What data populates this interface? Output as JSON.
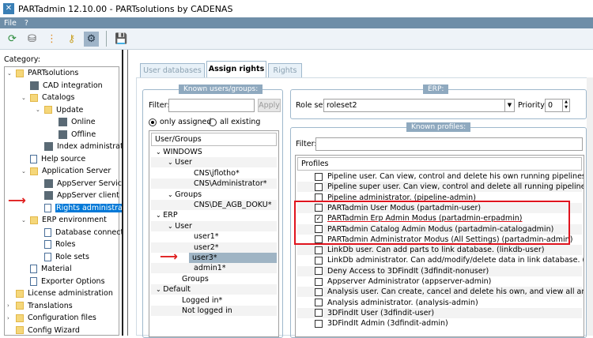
{
  "window": {
    "title": "PARTadmin 12.10.00 - PARTsolutions by CADENAS"
  },
  "menu": [
    "File",
    "?"
  ],
  "toolbar": {
    "icons": [
      "update-icon",
      "database-icon",
      "index-icon",
      "keys-icon",
      "settings-icon",
      "save-icon"
    ]
  },
  "category": {
    "label": "Category:",
    "tree": [
      {
        "label": "PARTsolutions",
        "level": 0,
        "icon": "folder",
        "exp": "v"
      },
      {
        "label": "CAD integration",
        "level": 1,
        "icon": "app"
      },
      {
        "label": "Catalogs",
        "level": 1,
        "icon": "folder",
        "exp": "v"
      },
      {
        "label": "Update",
        "level": 2,
        "icon": "folder",
        "exp": "v"
      },
      {
        "label": "Online",
        "level": 3,
        "icon": "app"
      },
      {
        "label": "Offline",
        "level": 3,
        "icon": "app"
      },
      {
        "label": "Index administration",
        "level": 2,
        "icon": "app"
      },
      {
        "label": "Help source",
        "level": 1,
        "icon": "doc"
      },
      {
        "label": "Application Server",
        "level": 1,
        "icon": "folder",
        "exp": "v"
      },
      {
        "label": "AppServer Service",
        "level": 2,
        "icon": "app"
      },
      {
        "label": "AppServer client",
        "level": 2,
        "icon": "app"
      },
      {
        "label": "Rights administration",
        "level": 2,
        "icon": "doc",
        "selected": true
      },
      {
        "label": "ERP environment",
        "level": 1,
        "icon": "folder",
        "exp": "v"
      },
      {
        "label": "Database connection",
        "level": 2,
        "icon": "doc"
      },
      {
        "label": "Roles",
        "level": 2,
        "icon": "doc"
      },
      {
        "label": "Role sets",
        "level": 2,
        "icon": "doc"
      },
      {
        "label": "Material",
        "level": 1,
        "icon": "doc"
      },
      {
        "label": "Exporter Options",
        "level": 1,
        "icon": "doc"
      },
      {
        "label": "License administration",
        "level": 0,
        "icon": "folder"
      },
      {
        "label": "Translations",
        "level": 0,
        "icon": "folder",
        "exp": ">"
      },
      {
        "label": "Configuration files",
        "level": 0,
        "icon": "folder",
        "exp": ">"
      },
      {
        "label": "Config Wizard",
        "level": 0,
        "icon": "folder"
      }
    ]
  },
  "tabs": [
    {
      "label": "User databases"
    },
    {
      "label": "Assign rights",
      "active": true
    },
    {
      "label": "Rights"
    }
  ],
  "users": {
    "group_title": "Known users/groups:",
    "filter_label": "Filter:",
    "filter_value": "",
    "apply": "Apply",
    "radio_assigned": "only assigned",
    "radio_all": "all existing",
    "header": "User/Groups",
    "rows": [
      {
        "label": "WINDOWS",
        "level": 0,
        "exp": "v"
      },
      {
        "label": "User",
        "level": 1,
        "exp": "v"
      },
      {
        "label": "CNS\\jflotho*",
        "level": 2
      },
      {
        "label": "CNS\\Administrator*",
        "level": 2
      },
      {
        "label": "Groups",
        "level": 1,
        "exp": "v"
      },
      {
        "label": "CNS\\DE_AGB_DOKU*",
        "level": 2
      },
      {
        "label": "ERP",
        "level": 0,
        "exp": "v"
      },
      {
        "label": "User",
        "level": 1,
        "exp": "v"
      },
      {
        "label": "user1*",
        "level": 2
      },
      {
        "label": "user2*",
        "level": 2
      },
      {
        "label": "user3*",
        "level": 2,
        "selected": true
      },
      {
        "label": "admin1*",
        "level": 2
      },
      {
        "label": "Groups",
        "level": 1
      },
      {
        "label": "Default",
        "level": 0,
        "exp": "v"
      },
      {
        "label": "Logged in*",
        "level": 1
      },
      {
        "label": "Not logged in",
        "level": 1
      }
    ]
  },
  "erp": {
    "group_title": "ERP:",
    "roleset_label": "Role set:",
    "roleset_value": "roleset2",
    "priority_label": "Priority:",
    "priority_value": "0"
  },
  "profiles": {
    "group_title": "Known profiles:",
    "filter_label": "Filter:",
    "filter_value": "",
    "header": "Profiles",
    "rows": [
      {
        "label": "Pipeline user. Can view, control and delete his own running pipelines. Can vie...",
        "checked": false
      },
      {
        "label": "Pipeline super user. Can view, control and delete all running pipelines. (pipeli...",
        "checked": false
      },
      {
        "label": "Pipeline administrator. (pipeline-admin)",
        "checked": false
      },
      {
        "label": "PARTadmin User Modus (partadmin-user)",
        "checked": false
      },
      {
        "label": "PARTadmin Erp Admin Modus (partadmin-erpadmin)",
        "checked": true
      },
      {
        "label": "PARTadmin Catalog Admin Modus (partadmin-catalogadmin)",
        "checked": false
      },
      {
        "label": "PARTadmin Administrator Modus (All Settings) (partadmin-admin)",
        "checked": false
      },
      {
        "label": "LinkDb user. Can add parts to link database. (linkdb-user)",
        "checked": false
      },
      {
        "label": "LinkDb administrator. Can add/modify/delete data in link database. (linkdb-a...",
        "checked": false
      },
      {
        "label": "Deny Access to 3DFindIt (3dfindit-nonuser)",
        "checked": false
      },
      {
        "label": "Appserver Administrator (appserver-admin)",
        "checked": false
      },
      {
        "label": "Analysis user. Can create, cancel and delete his own, and view all analyses (an...",
        "checked": false
      },
      {
        "label": "Analysis administrator. (analysis-admin)",
        "checked": false
      },
      {
        "label": "3DFindIt User (3dfindit-user)",
        "checked": false
      },
      {
        "label": "3DFindIt Admin (3dfindit-admin)",
        "checked": false
      }
    ]
  },
  "colors": {
    "accent": "#0078d7",
    "annotation": "#e0141e",
    "menubar": "#6f8ea8"
  }
}
